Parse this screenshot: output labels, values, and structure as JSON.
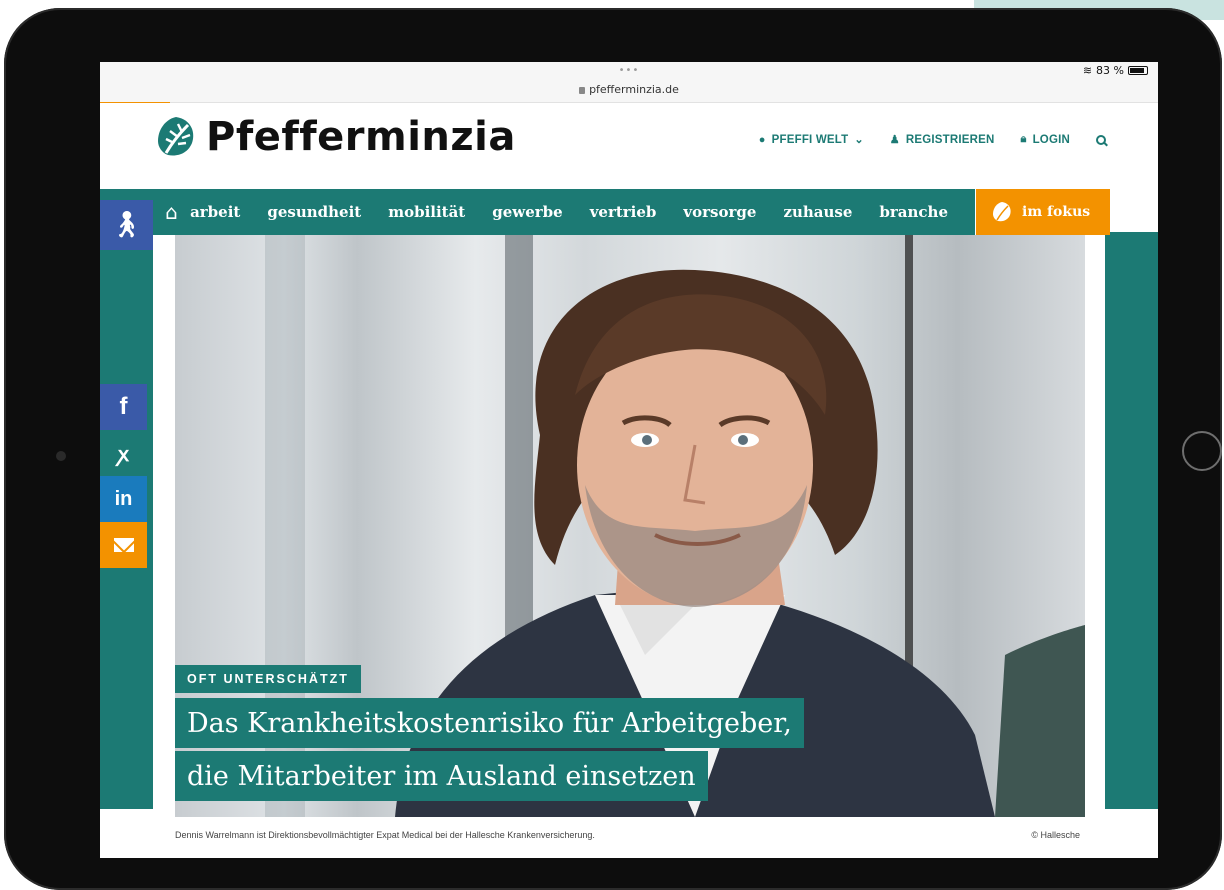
{
  "browser": {
    "dots": "•••",
    "url": "pfefferminzia.de",
    "battery": "83 %"
  },
  "header": {
    "logo_text": "Pfefferminzia",
    "nav": [
      {
        "label": "PFEFFI WELT",
        "icon": "globe-icon"
      },
      {
        "label": "REGISTRIEREN",
        "icon": "user-icon"
      },
      {
        "label": "LOGIN",
        "icon": "lock-icon"
      }
    ]
  },
  "categories": [
    "arbeit",
    "gesundheit",
    "mobilität",
    "gewerbe",
    "vertrieb",
    "vorsorge",
    "zuhause",
    "branche"
  ],
  "fokus_label": "im fokus",
  "share": {
    "facebook": "f",
    "xing": "ꭗ",
    "linkedin": "in"
  },
  "hero": {
    "tag": "OFT UNTERSCHÄTZT",
    "title_line_1": "Das Krankheitskostenrisiko für Arbeitgeber,",
    "title_line_2": "die Mitarbeiter im Ausland einsetzen"
  },
  "caption": {
    "text": "Dennis Warrelmann ist Direktionsbevollmächtigter Expat Medical bei der Hallesche Krankenversicherung.",
    "credit": "© Hallesche"
  },
  "colors": {
    "teal": "#1c7a74",
    "orange": "#f39200",
    "blue": "#3a5aa8"
  }
}
